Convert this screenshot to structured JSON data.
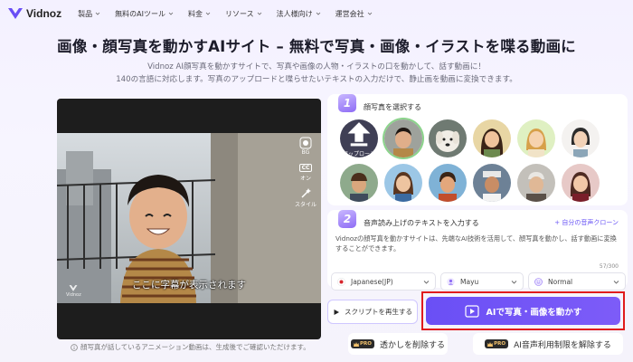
{
  "nav": {
    "brand": "Vidnoz",
    "items": [
      "製品",
      "無料のAIツール",
      "料金",
      "リソース",
      "法人様向け",
      "運営会社"
    ]
  },
  "hero": {
    "title": "画像・顔写真を動かすAIサイト – 無料で写真・画像・イラストを喋る動画に",
    "subtitle_line1": "Vidnoz AI顔写真を動かすサイトで、写真や画像の人物・イラストの口を動かして、話す動画に！",
    "subtitle_line2": "140の言語に対応します。写真のアップロードと喋らせたいテキストの入力だけで、静止画を動画に変換できます。"
  },
  "video": {
    "tools": [
      "BG",
      "オン",
      "スタイル"
    ],
    "cc_label": "CC",
    "caption": "ここに字幕が表示されます",
    "watermark": "Vidnoz"
  },
  "note": "顔写真が話しているアニメーション動画は、生成後でご確認いただけます。",
  "step1": {
    "number": "1",
    "title": "顔写真を選択する",
    "upload_label": "アップロード"
  },
  "step2": {
    "number": "2",
    "title": "音声読み上げのテキストを入力する",
    "clone_link": "+ 自分の音声クローン",
    "text": "Vidnozの顔写真を動かすサイトは、先端なAI技術を活用して、顔写真を動かし、話す動画に変換することができます。",
    "counter": "57/300"
  },
  "selects": {
    "language": "Japanese(JP)",
    "voice": "Mayu",
    "style": "Normal"
  },
  "buttons": {
    "play_script": "スクリプトを再生する",
    "animate": "AIで写真・画像を動かす",
    "remove_watermark": "透かしを削除する",
    "remove_limit": "AI音声利用制限を解除する",
    "pro": "PRO"
  },
  "colors": {
    "accent": "#6a4ff5",
    "highlight": "#e01c1c"
  }
}
